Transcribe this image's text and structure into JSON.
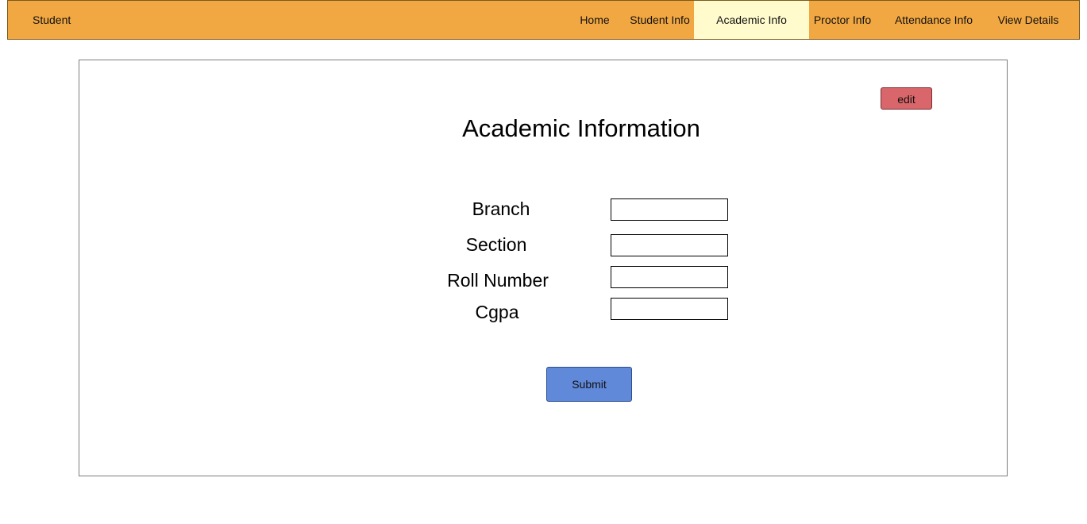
{
  "navbar": {
    "brand": "Student",
    "items": [
      {
        "label": "Home"
      },
      {
        "label": "Student Info"
      },
      {
        "label": "Academic Info"
      },
      {
        "label": "Proctor Info"
      },
      {
        "label": "Attendance Info"
      },
      {
        "label": "View Details"
      }
    ],
    "active_item": "Academic Info",
    "bg_color": "#f2a842",
    "active_color": "#fffbcc"
  },
  "panel": {
    "edit_label": "edit",
    "title": "Academic Information",
    "fields": [
      {
        "label": "Branch",
        "value": ""
      },
      {
        "label": "Section",
        "value": ""
      },
      {
        "label": "Roll Number",
        "value": ""
      },
      {
        "label": "Cgpa",
        "value": ""
      }
    ],
    "submit_label": "Submit",
    "edit_color": "#d9666a",
    "submit_color": "#6189d9"
  }
}
